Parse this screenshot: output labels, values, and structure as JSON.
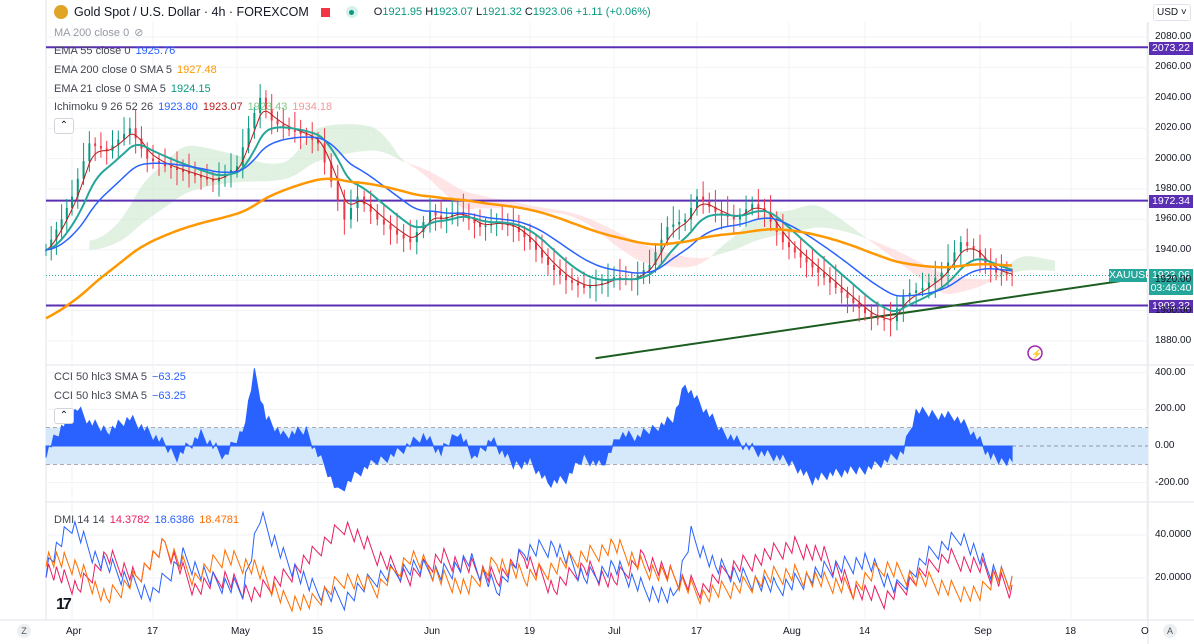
{
  "header": {
    "symbol_title": "Gold Spot / U.S. Dollar · 4h · FOREXCOM",
    "o_label": "O",
    "o": "1921.95",
    "h_label": "H",
    "h": "1923.07",
    "l_label": "L",
    "l": "1921.32",
    "c_label": "C",
    "c": "1923.06",
    "change": "+1.11 (+0.06%)"
  },
  "currency": "USD",
  "indicators": {
    "ma200": {
      "label": "MA 200 close 0"
    },
    "ema55": {
      "label": "EMA 55 close 0",
      "value": "1925.76"
    },
    "ema200": {
      "label": "EMA 200 close 0 SMA 5",
      "value": "1927.48"
    },
    "ema21": {
      "label": "EMA 21 close 0 SMA 5",
      "value": "1924.15"
    },
    "ichimoku": {
      "label": "Ichimoku 9 26 52 26",
      "v1": "1923.80",
      "v2": "1923.07",
      "v3": "1923.43",
      "v4": "1934.18"
    },
    "cci1": {
      "label": "CCI 50 hlc3 SMA 5",
      "value": "−63.25"
    },
    "cci2": {
      "label": "CCI 50 hlc3 SMA 5",
      "value": "−63.25"
    },
    "dmi": {
      "label": "DMI 14 14",
      "v1": "14.3782",
      "v2": "18.6386",
      "v3": "18.4781"
    }
  },
  "price_labels": {
    "level1": "2073.22",
    "level2": "1972.34",
    "level3": "1903.32",
    "symbol_tag": "XAUUSD",
    "last": "1923.06",
    "countdown": "03:46:40"
  },
  "colors": {
    "up": "#089981",
    "level": "#5b2fb4",
    "ema200": "#ff9800",
    "ema55": "#2962ff",
    "cci": "#2962ff",
    "trend": "#1b5e20"
  },
  "chart_data": [
    {
      "type": "line",
      "title": "Gold Spot / U.S. Dollar 4h",
      "ylim": [
        1860,
        2090
      ],
      "yticks": [
        "2080.00",
        "2060.00",
        "2040.00",
        "2020.00",
        "2000.00",
        "1980.00",
        "1960.00",
        "1940.00",
        "1920.00",
        "1900.00",
        "1880.00"
      ],
      "x_unit": "days since Apr 1",
      "close": [
        [
          -3,
          1940
        ],
        [
          0,
          1960
        ],
        [
          2,
          1975
        ],
        [
          5,
          2010
        ],
        [
          8,
          2005
        ],
        [
          12,
          2020
        ],
        [
          15,
          2000
        ],
        [
          18,
          1995
        ],
        [
          22,
          1990
        ],
        [
          26,
          1985
        ],
        [
          30,
          1995
        ],
        [
          32,
          2020
        ],
        [
          34,
          2040
        ],
        [
          36,
          2025
        ],
        [
          38,
          2020
        ],
        [
          42,
          2015
        ],
        [
          44,
          2010
        ],
        [
          46,
          1985
        ],
        [
          48,
          1960
        ],
        [
          50,
          1975
        ],
        [
          53,
          1960
        ],
        [
          56,
          1950
        ],
        [
          58,
          1945
        ],
        [
          61,
          1965
        ],
        [
          63,
          1960
        ],
        [
          66,
          1965
        ],
        [
          70,
          1955
        ],
        [
          73,
          1958
        ],
        [
          76,
          1955
        ],
        [
          79,
          1945
        ],
        [
          82,
          1930
        ],
        [
          85,
          1920
        ],
        [
          88,
          1915
        ],
        [
          91,
          1918
        ],
        [
          93,
          1922
        ],
        [
          96,
          1920
        ],
        [
          99,
          1930
        ],
        [
          102,
          1955
        ],
        [
          105,
          1960
        ],
        [
          107,
          1975
        ],
        [
          110,
          1965
        ],
        [
          113,
          1960
        ],
        [
          116,
          1970
        ],
        [
          118,
          1965
        ],
        [
          121,
          1945
        ],
        [
          124,
          1935
        ],
        [
          127,
          1925
        ],
        [
          130,
          1915
        ],
        [
          133,
          1905
        ],
        [
          136,
          1895
        ],
        [
          139,
          1893
        ],
        [
          141,
          1910
        ],
        [
          144,
          1915
        ],
        [
          147,
          1925
        ],
        [
          150,
          1945
        ],
        [
          152,
          1940
        ],
        [
          154,
          1930
        ],
        [
          156,
          1925
        ],
        [
          159,
          1923
        ]
      ],
      "horizontal_levels": [
        2073.22,
        1972.34,
        1903.32
      ],
      "trendline": [
        [
          100,
          1870
        ],
        [
          183,
          1922
        ]
      ]
    },
    {
      "type": "area",
      "title": "CCI 50 hlc3 SMA 5",
      "ylim": [
        -250,
        420
      ],
      "yticks": [
        "400.00",
        "200.00",
        "0.00",
        "-200.00"
      ],
      "band": [
        -100,
        100
      ],
      "values": [
        [
          -3,
          -30
        ],
        [
          0,
          100
        ],
        [
          3,
          200
        ],
        [
          5,
          120
        ],
        [
          8,
          80
        ],
        [
          12,
          150
        ],
        [
          16,
          50
        ],
        [
          20,
          -50
        ],
        [
          24,
          60
        ],
        [
          28,
          -60
        ],
        [
          31,
          80
        ],
        [
          33,
          400
        ],
        [
          35,
          150
        ],
        [
          38,
          50
        ],
        [
          42,
          80
        ],
        [
          45,
          -100
        ],
        [
          47,
          -250
        ],
        [
          50,
          -150
        ],
        [
          53,
          -80
        ],
        [
          56,
          -30
        ],
        [
          60,
          50
        ],
        [
          63,
          -40
        ],
        [
          66,
          80
        ],
        [
          69,
          -60
        ],
        [
          72,
          30
        ],
        [
          76,
          -100
        ],
        [
          79,
          -80
        ],
        [
          82,
          -200
        ],
        [
          85,
          -180
        ],
        [
          88,
          -60
        ],
        [
          91,
          -100
        ],
        [
          94,
          60
        ],
        [
          97,
          40
        ],
        [
          100,
          100
        ],
        [
          103,
          150
        ],
        [
          105,
          330
        ],
        [
          108,
          200
        ],
        [
          111,
          80
        ],
        [
          114,
          20
        ],
        [
          117,
          -30
        ],
        [
          120,
          -60
        ],
        [
          123,
          -100
        ],
        [
          126,
          -180
        ],
        [
          129,
          -150
        ],
        [
          132,
          -140
        ],
        [
          135,
          -120
        ],
        [
          138,
          -80
        ],
        [
          141,
          -30
        ],
        [
          143,
          180
        ],
        [
          146,
          170
        ],
        [
          149,
          160
        ],
        [
          151,
          100
        ],
        [
          153,
          20
        ],
        [
          155,
          -60
        ],
        [
          157,
          -80
        ],
        [
          159,
          -63
        ]
      ]
    },
    {
      "type": "line",
      "title": "DMI 14 14",
      "ylim": [
        0,
        50
      ],
      "yticks": [
        "40.0000",
        "20.0000"
      ],
      "series": [
        {
          "name": "+DI",
          "color": "#e91e63",
          "values": [
            [
              -3,
              25
            ],
            [
              3,
              15
            ],
            [
              8,
              30
            ],
            [
              13,
              20
            ],
            [
              18,
              35
            ],
            [
              23,
              15
            ],
            [
              28,
              20
            ],
            [
              33,
              12
            ],
            [
              38,
              20
            ],
            [
              43,
              30
            ],
            [
              48,
              45
            ],
            [
              53,
              30
            ],
            [
              58,
              20
            ],
            [
              63,
              30
            ],
            [
              68,
              25
            ],
            [
              73,
              20
            ],
            [
              78,
              30
            ],
            [
              83,
              15
            ],
            [
              88,
              25
            ],
            [
              93,
              18
            ],
            [
              98,
              30
            ],
            [
              103,
              20
            ],
            [
              108,
              15
            ],
            [
              113,
              25
            ],
            [
              118,
              30
            ],
            [
              123,
              35
            ],
            [
              128,
              30
            ],
            [
              133,
              15
            ],
            [
              138,
              10
            ],
            [
              143,
              20
            ],
            [
              148,
              30
            ],
            [
              153,
              25
            ],
            [
              156,
              20
            ],
            [
              159,
              14.4
            ]
          ]
        },
        {
          "name": "-DI",
          "color": "#2962ff",
          "values": [
            [
              -3,
              25
            ],
            [
              2,
              45
            ],
            [
              6,
              30
            ],
            [
              11,
              20
            ],
            [
              16,
              12
            ],
            [
              21,
              30
            ],
            [
              26,
              18
            ],
            [
              31,
              15
            ],
            [
              34,
              48
            ],
            [
              38,
              30
            ],
            [
              43,
              15
            ],
            [
              48,
              10
            ],
            [
              53,
              20
            ],
            [
              58,
              25
            ],
            [
              63,
              22
            ],
            [
              68,
              28
            ],
            [
              73,
              15
            ],
            [
              78,
              32
            ],
            [
              83,
              35
            ],
            [
              88,
              20
            ],
            [
              93,
              25
            ],
            [
              98,
              15
            ],
            [
              103,
              10
            ],
            [
              106,
              40
            ],
            [
              110,
              25
            ],
            [
              115,
              20
            ],
            [
              120,
              15
            ],
            [
              125,
              20
            ],
            [
              130,
              25
            ],
            [
              135,
              28
            ],
            [
              140,
              15
            ],
            [
              145,
              30
            ],
            [
              150,
              40
            ],
            [
              154,
              25
            ],
            [
              159,
              18.6
            ]
          ]
        },
        {
          "name": "ADX",
          "color": "#ff6d00",
          "values": [
            [
              -3,
              30
            ],
            [
              3,
              25
            ],
            [
              8,
              10
            ],
            [
              13,
              20
            ],
            [
              18,
              35
            ],
            [
              23,
              20
            ],
            [
              28,
              30
            ],
            [
              33,
              25
            ],
            [
              38,
              10
            ],
            [
              43,
              8
            ],
            [
              48,
              20
            ],
            [
              53,
              15
            ],
            [
              58,
              30
            ],
            [
              63,
              20
            ],
            [
              68,
              15
            ],
            [
              73,
              28
            ],
            [
              78,
              20
            ],
            [
              83,
              25
            ],
            [
              88,
              30
            ],
            [
              93,
              35
            ],
            [
              98,
              25
            ],
            [
              103,
              20
            ],
            [
              108,
              12
            ],
            [
              113,
              15
            ],
            [
              118,
              20
            ],
            [
              123,
              22
            ],
            [
              128,
              18
            ],
            [
              133,
              15
            ],
            [
              138,
              25
            ],
            [
              143,
              20
            ],
            [
              148,
              15
            ],
            [
              153,
              12
            ],
            [
              156,
              22
            ],
            [
              159,
              18.5
            ]
          ]
        }
      ]
    }
  ],
  "time_axis": {
    "labels": [
      "Apr",
      "17",
      "May",
      "15",
      "Jun",
      "19",
      "Jul",
      "17",
      "Aug",
      "14",
      "Sep",
      "18",
      "O"
    ],
    "z_button": "Z",
    "a_button": "A"
  },
  "logo": "17"
}
